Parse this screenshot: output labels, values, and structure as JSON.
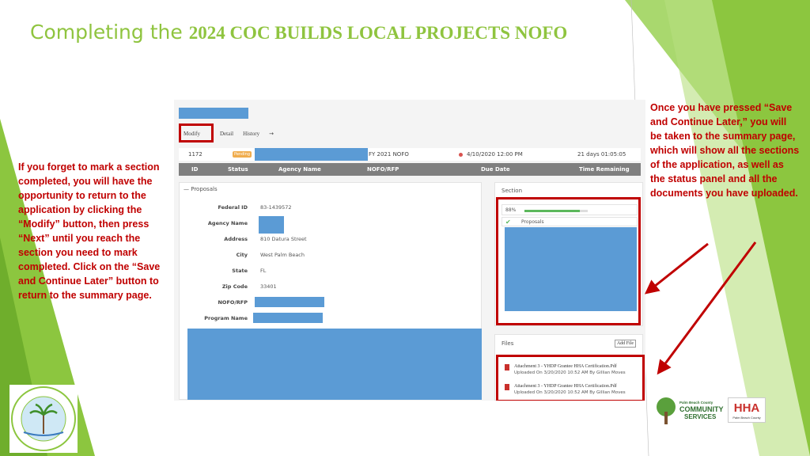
{
  "slide": {
    "title_lead": "Completing the ",
    "title_main": "2024 COC BUILDS LOCAL PROJECTS NOFO"
  },
  "notes": {
    "left": "If you forget to mark a section completed, you will have the opportunity to return to the application by clicking the “Modify” button, then press “Next” until you reach the section you need to mark completed. Click on the “Save and Continue Later” button to return to the summary page.",
    "right": "Once you have pressed “Save and Continue Later,” you will be taken to the summary page, which will show all the sections of the application, as well as the status panel and all the documents you have uploaded."
  },
  "app": {
    "tabs": [
      "Modify",
      "Detail",
      "History"
    ],
    "row": {
      "id": "1172",
      "status": "Pending",
      "nofo": "FY 2021 NOFO",
      "due_date": "4/10/2020 12:00 PM",
      "time_remaining": "21 days 01:05:05"
    },
    "columns": [
      "ID",
      "Status",
      "Agency Name",
      "NOFO/RFP",
      "Due Date",
      "Time Remaining"
    ],
    "proposals": {
      "title": "— Proposals",
      "fields": [
        {
          "label": "Federal ID",
          "value": "83-1439572"
        },
        {
          "label": "Agency Name",
          "value": ""
        },
        {
          "label": "Address",
          "value": "810 Datura Street"
        },
        {
          "label": "City",
          "value": "West Palm Beach"
        },
        {
          "label": "State",
          "value": "FL"
        },
        {
          "label": "Zip Code",
          "value": "33401"
        },
        {
          "label": "NOFO/RFP",
          "value": ""
        },
        {
          "label": "Program Name",
          "value": ""
        }
      ]
    },
    "section_panel": {
      "title": "Section",
      "progress_label": "88%",
      "progress": 0.88,
      "item": "Proposals"
    },
    "files_panel": {
      "title": "Files",
      "add_label": "Add File",
      "files": [
        {
          "name": "Attachment 3 - YHDP Grantee HHA Certification.Pdf",
          "meta": "Uploaded On 3/20/2020 10:52 AM By Gillian Moves"
        },
        {
          "name": "Attachment 3 - YHDP Grantee HHA Certification.Pdf",
          "meta": "Uploaded On 3/20/2020 10:52 AM By Gillian Moves"
        }
      ]
    }
  },
  "logos": {
    "left_text": "PALM BEACH COUNTY · FLORIDA",
    "pbc_line1": "Palm Beach County",
    "pbc_line2": "COMMUNITY",
    "pbc_line3": "SERVICES",
    "hha_main": "HHA",
    "hha_sub": "Palm Beach County"
  },
  "colors": {
    "accent_green": "#8fc43f",
    "note_red": "#c00000",
    "redacted_blue": "#5b9bd5"
  }
}
